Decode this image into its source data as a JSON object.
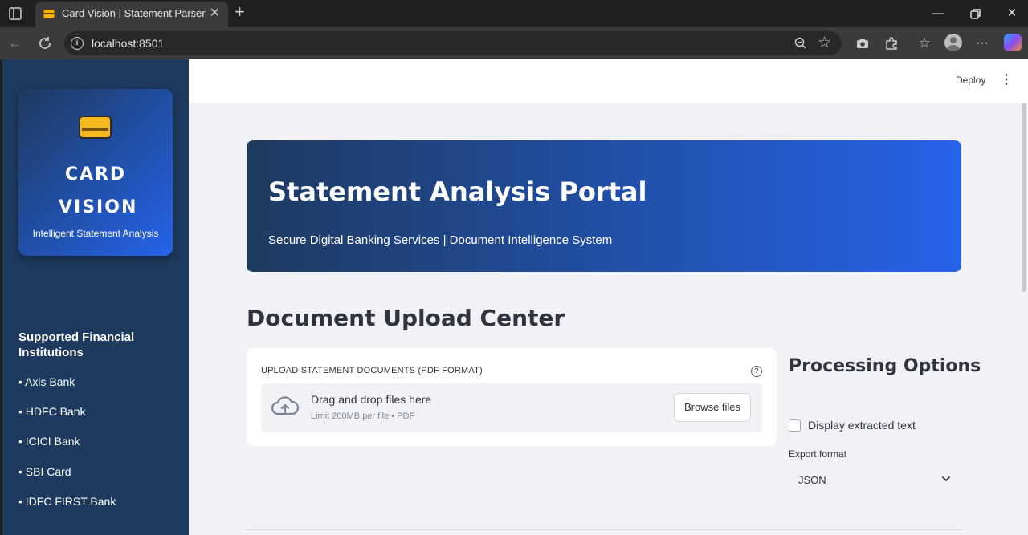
{
  "browser": {
    "tab_title": "Card Vision | Statement Parser",
    "tab_close": "✕",
    "new_tab": "+",
    "address": "localhost:8501",
    "info_glyph": "i"
  },
  "header": {
    "deploy_label": "Deploy",
    "menu_glyph": "⋮"
  },
  "sidebar": {
    "brand_title": "CARD VISION",
    "brand_tagline": "Intelligent Statement Analysis",
    "institutions_heading": "Supported Financial Institutions",
    "institutions": [
      "• Axis Bank",
      "• HDFC Bank",
      "• ICICI Bank",
      "• SBI Card",
      "• IDFC FIRST Bank"
    ]
  },
  "hero": {
    "title": "Statement Analysis Portal",
    "subtitle": "Secure Digital Banking Services | Document Intelligence System"
  },
  "upload": {
    "section_title": "Document Upload Center",
    "label": "UPLOAD STATEMENT DOCUMENTS (PDF FORMAT)",
    "help_glyph": "?",
    "drop_title": "Drag and drop files here",
    "drop_limit": "Limit 200MB per file • PDF",
    "browse_label": "Browse files"
  },
  "options": {
    "title": "Processing Options",
    "display_text_label": "Display extracted text",
    "display_text_checked": false,
    "export_label": "Export format",
    "export_value": "JSON"
  },
  "colors": {
    "sidebar_bg": "#1e3a5f",
    "accent_blue": "#2563eb",
    "page_bg": "#f0f2f6",
    "text": "#31333f"
  }
}
